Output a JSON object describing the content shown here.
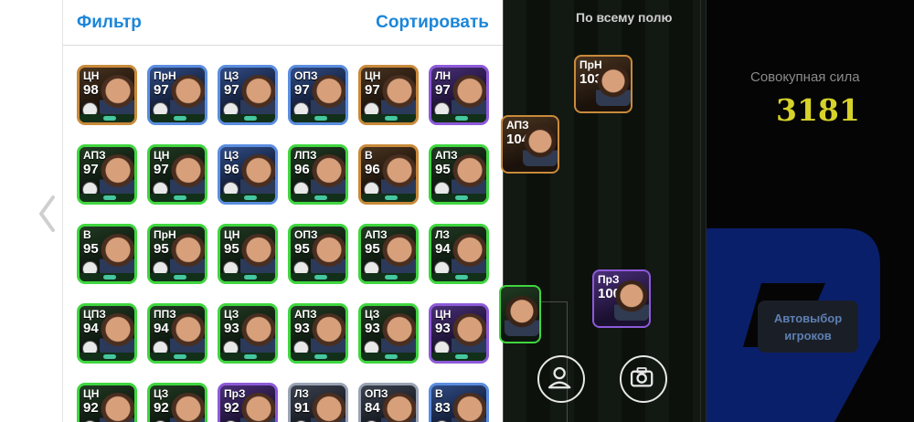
{
  "header": {
    "filter_label": "Фильтр",
    "sort_label": "Сортировать"
  },
  "cards": [
    {
      "pos": "ЦН",
      "rating": "98",
      "style": "gold"
    },
    {
      "pos": "ПрН",
      "rating": "97",
      "style": "blue"
    },
    {
      "pos": "ЦЗ",
      "rating": "97",
      "style": "blue"
    },
    {
      "pos": "ОПЗ",
      "rating": "97",
      "style": "blue"
    },
    {
      "pos": "ЦН",
      "rating": "97",
      "style": "gold"
    },
    {
      "pos": "ЛН",
      "rating": "97",
      "style": "purple"
    },
    {
      "pos": "АПЗ",
      "rating": "97",
      "style": "green"
    },
    {
      "pos": "ЦН",
      "rating": "97",
      "style": "green"
    },
    {
      "pos": "ЦЗ",
      "rating": "96",
      "style": "blue"
    },
    {
      "pos": "ЛПЗ",
      "rating": "96",
      "style": "green"
    },
    {
      "pos": "В",
      "rating": "96",
      "style": "gold"
    },
    {
      "pos": "АПЗ",
      "rating": "95",
      "style": "green"
    },
    {
      "pos": "В",
      "rating": "95",
      "style": "green"
    },
    {
      "pos": "ПрН",
      "rating": "95",
      "style": "green"
    },
    {
      "pos": "ЦН",
      "rating": "95",
      "style": "green"
    },
    {
      "pos": "ОПЗ",
      "rating": "95",
      "style": "green"
    },
    {
      "pos": "АПЗ",
      "rating": "95",
      "style": "green"
    },
    {
      "pos": "ЛЗ",
      "rating": "94",
      "style": "green"
    },
    {
      "pos": "ЦПЗ",
      "rating": "94",
      "style": "green"
    },
    {
      "pos": "ППЗ",
      "rating": "94",
      "style": "green"
    },
    {
      "pos": "ЦЗ",
      "rating": "93",
      "style": "green"
    },
    {
      "pos": "АПЗ",
      "rating": "93",
      "style": "green"
    },
    {
      "pos": "ЦЗ",
      "rating": "93",
      "style": "green"
    },
    {
      "pos": "ЦН",
      "rating": "93",
      "style": "purple"
    },
    {
      "pos": "ЦН",
      "rating": "92",
      "style": "green"
    },
    {
      "pos": "ЦЗ",
      "rating": "92",
      "style": "green"
    },
    {
      "pos": "ПрЗ",
      "rating": "92",
      "style": "purple"
    },
    {
      "pos": "ЛЗ",
      "rating": "91",
      "style": "silver"
    },
    {
      "pos": "ОПЗ",
      "rating": "84",
      "style": "silver"
    },
    {
      "pos": "В",
      "rating": "83",
      "style": "blue"
    }
  ],
  "pitch": {
    "title": "По всему полю",
    "players": [
      {
        "pos": "ПрН",
        "rating": "103",
        "style": ""
      },
      {
        "pos": "АПЗ",
        "rating": "104",
        "style": ""
      },
      {
        "pos": "ПрЗ",
        "rating": "100",
        "style": "purple"
      },
      {
        "pos": "",
        "rating": "",
        "style": "green"
      }
    ]
  },
  "side": {
    "strength_label": "Совокупная сила",
    "strength_value": "3181",
    "auto_line1": "Автовыбор",
    "auto_line2": "игроков"
  }
}
